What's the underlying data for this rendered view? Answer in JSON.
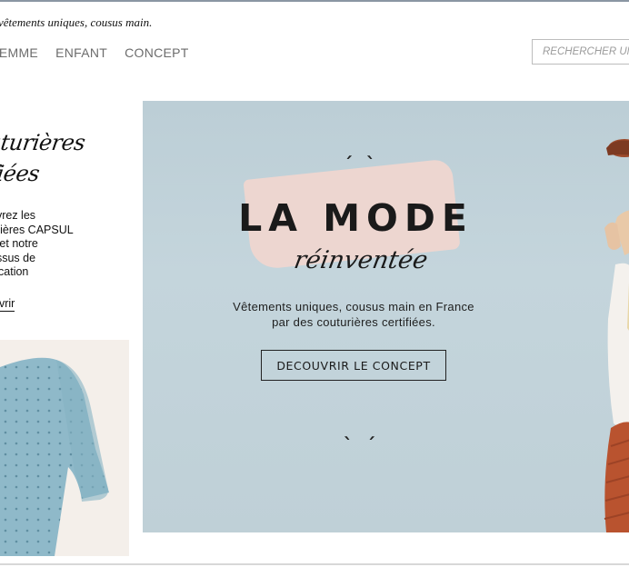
{
  "header": {
    "tagline": "vêtements uniques, cousus main."
  },
  "nav": {
    "items": [
      "FEMME",
      "ENFANT",
      "CONCEPT"
    ]
  },
  "search": {
    "placeholder": "RECHERCHER UN"
  },
  "promo": {
    "title_line1": "outurières",
    "title_line2": "tifiées",
    "text_lines": [
      "uvrez les",
      "urières CAPSUL",
      "o et notre",
      "essus de",
      "ification"
    ],
    "link": "uvrir"
  },
  "hero": {
    "title": "LA MODE",
    "script": "réinventée",
    "subtitle_line1": "Vêtements uniques, cousus main en France",
    "subtitle_line2": "par des couturières certifiées.",
    "button": "DECOUVRIR LE CONCEPT",
    "quote_top": "ˏ ˎ",
    "quote_bottom": "ˎ ˏ",
    "background_color": "#c1d2d9",
    "accent_color": "#efd6d0"
  }
}
